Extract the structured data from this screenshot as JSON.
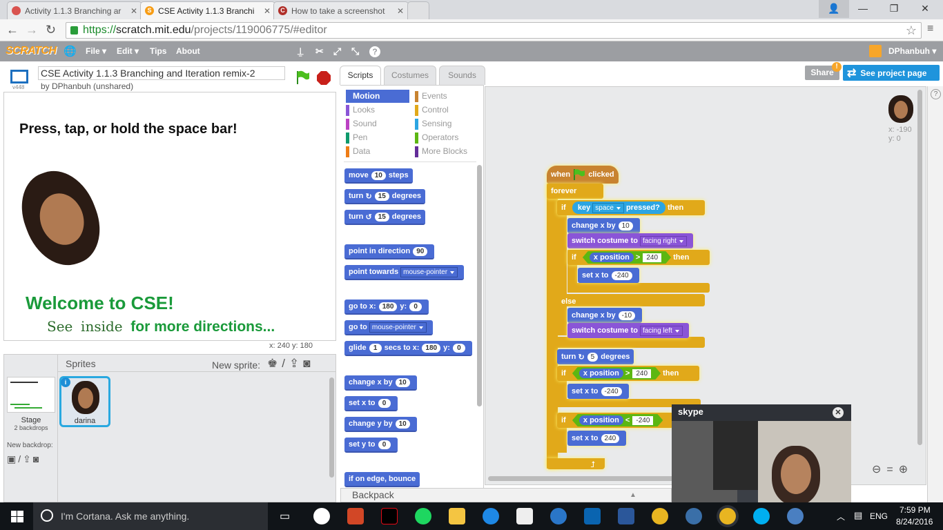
{
  "browser": {
    "tabs": [
      {
        "title": "Activity 1.1.3 Branching ar",
        "active": false
      },
      {
        "title": "CSE Activity 1.1.3 Branchi",
        "active": true
      },
      {
        "title": "How to take a screenshot",
        "active": false
      }
    ],
    "url_scheme": "https://",
    "url_host": "scratch.mit.edu",
    "url_path": "/projects/119006775/#editor"
  },
  "menubar": {
    "logo": "SCRATCH",
    "items": [
      "File ▾",
      "Edit ▾",
      "Tips",
      "About"
    ],
    "user": "DPhanbuh ▾"
  },
  "project": {
    "title": "CSE Activity 1.1.3 Branching and Iteration remix-2",
    "byline": "by DPhanbuh (unshared)",
    "version": "v448"
  },
  "stage": {
    "headline": "Press, tap, or hold the space bar!",
    "welcome": "Welcome to CSE!",
    "see": "See",
    "inside": "inside",
    "more": "for more directions...",
    "coords": "x: 240   y: 180"
  },
  "sprites_pane": {
    "header": "Sprites",
    "new_sprite_label": "New sprite:",
    "stage_label": "Stage",
    "stage_backdrops": "2 backdrops",
    "new_backdrop_label": "New backdrop:",
    "sprite_name": "darina"
  },
  "editor_tabs": [
    "Scripts",
    "Costumes",
    "Sounds"
  ],
  "share_label": "Share",
  "see_project_label": "See project page",
  "categories_left": [
    "Motion",
    "Looks",
    "Sound",
    "Pen",
    "Data"
  ],
  "categories_right": [
    "Events",
    "Control",
    "Sensing",
    "Operators",
    "More Blocks"
  ],
  "category_colors": {
    "Motion": "#4a6cd4",
    "Looks": "#8a55d7",
    "Sound": "#bb42c3",
    "Pen": "#0e9a6c",
    "Data": "#ee7d16",
    "Events": "#c88330",
    "Control": "#e1a91a",
    "Sensing": "#2ca5e2",
    "Operators": "#5cb712",
    "More Blocks": "#632d99"
  },
  "palette": {
    "move": {
      "pre": "move",
      "val": "10",
      "post": "steps"
    },
    "turn_right": {
      "pre": "turn",
      "icon": "↻",
      "val": "15",
      "post": "degrees"
    },
    "turn_left": {
      "pre": "turn",
      "icon": "↺",
      "val": "15",
      "post": "degrees"
    },
    "point_dir": {
      "pre": "point in direction",
      "val": "90"
    },
    "point_towards": {
      "pre": "point towards",
      "val": "mouse-pointer"
    },
    "goto_xy": {
      "pre": "go to x:",
      "x": "180",
      "mid": "y:",
      "y": "0"
    },
    "goto": {
      "pre": "go to",
      "val": "mouse-pointer"
    },
    "glide": {
      "pre": "glide",
      "secs": "1",
      "mid1": "secs to x:",
      "x": "180",
      "mid2": "y:",
      "y": "0"
    },
    "change_x": {
      "pre": "change x by",
      "val": "10"
    },
    "set_x": {
      "pre": "set x to",
      "val": "0"
    },
    "change_y": {
      "pre": "change y by",
      "val": "10"
    },
    "set_y": {
      "pre": "set y to",
      "val": "0"
    },
    "edge": {
      "pre": "if on edge, bounce"
    }
  },
  "sprite_info": {
    "x": "x: -190",
    "y": "y: 0"
  },
  "script": {
    "when": "when",
    "clicked": "clicked",
    "forever": "forever",
    "if": "if",
    "then": "then",
    "else": "else",
    "key": "key",
    "key_val": "space",
    "pressed": "pressed?",
    "change_x": "change x by",
    "val_10": "10",
    "val_neg10": "-10",
    "switch": "switch costume to",
    "facing_right": "facing right",
    "facing_left": "facing left",
    "x_position": "x position",
    "gt": ">",
    "lt": "<",
    "val_240": "240",
    "val_neg240": "-240",
    "set_x": "set x to",
    "turn": "turn",
    "turn_val": "5",
    "degrees": "degrees"
  },
  "backpack_label": "Backpack",
  "skype": {
    "label": "skype"
  },
  "taskbar": {
    "cortana": "I'm Cortana. Ask me anything.",
    "lang": "ENG",
    "time": "7:59 PM",
    "date": "8/24/2016"
  }
}
